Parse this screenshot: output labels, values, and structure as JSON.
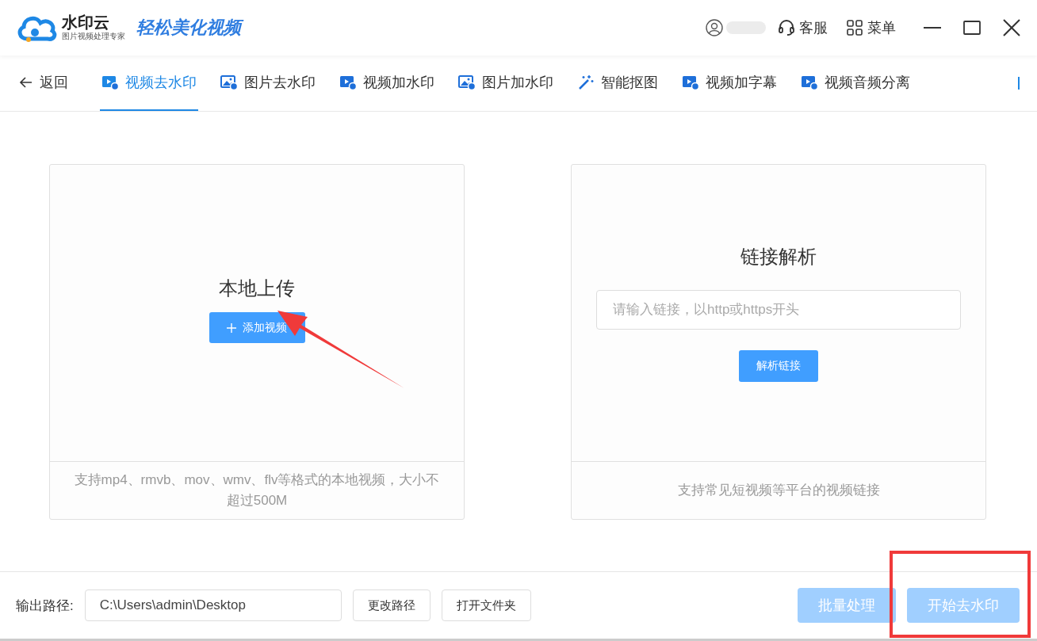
{
  "header": {
    "brand": "水印云",
    "brand_subtitle": "图片视频处理专家",
    "slogan": "轻松美化视频",
    "actions": [
      {
        "kind": "service",
        "label": "客服"
      },
      {
        "kind": "menu",
        "label": "菜单"
      }
    ]
  },
  "nav": {
    "back": "返回",
    "tabs": [
      {
        "label": "视频去水印",
        "kind": "video",
        "selected": true
      },
      {
        "label": "图片去水印",
        "kind": "image",
        "selected": false
      },
      {
        "label": "视频加水印",
        "kind": "video",
        "selected": false
      },
      {
        "label": "图片加水印",
        "kind": "image",
        "selected": false
      },
      {
        "label": "智能抠图",
        "kind": "wand",
        "selected": false
      },
      {
        "label": "视频加字幕",
        "kind": "video",
        "selected": false
      },
      {
        "label": "视频音频分离",
        "kind": "video",
        "selected": false
      }
    ]
  },
  "local_upload": {
    "title": "本地上传",
    "button": "添加视频",
    "note": "支持mp4、rmvb、mov、wmv、flv等格式的本地视频，大小不超过500M"
  },
  "link_parse": {
    "title": "链接解析",
    "placeholder": "请输入链接，以http或https开头",
    "button": "解析链接",
    "note": "支持常见短视频等平台的视频链接"
  },
  "footer": {
    "output_label": "输出路径:",
    "output_path": "C:\\Users\\admin\\Desktop",
    "buttons": [
      {
        "label": "更改路径",
        "kind": "plain"
      },
      {
        "label": "打开文件夹",
        "kind": "plain"
      },
      {
        "label": "批量处理",
        "kind": "primary",
        "disabled": true
      },
      {
        "label": "开始去水印",
        "kind": "primary",
        "disabled": true
      }
    ]
  }
}
